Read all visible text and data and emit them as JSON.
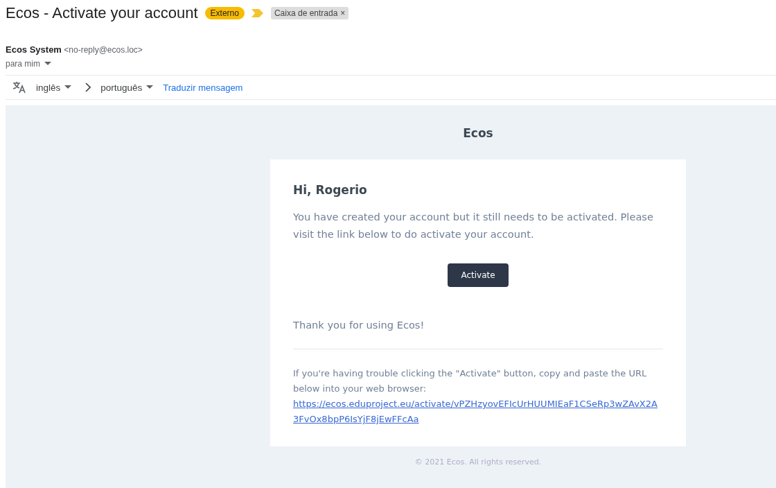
{
  "subject": "Ecos - Activate your account",
  "labels": [
    {
      "text": "Externo",
      "kind": "external"
    },
    {
      "text": "Caixa de entrada",
      "kind": "inbox",
      "close": "×"
    }
  ],
  "sender": {
    "name": "Ecos System",
    "address": "<no-reply@ecos.loc>",
    "recipient": "para mim"
  },
  "translate": {
    "from": "inglês",
    "to": "português",
    "action": "Traduzir mensagem"
  },
  "email": {
    "brand": "Ecos",
    "greeting": "Hi, Rogerio",
    "intro": "You have created your account but it still needs to be activated. Please visit the link below to do activate your account.",
    "button": "Activate",
    "thanks": "Thank you for using Ecos!",
    "trouble": "If you're having trouble clicking the \"Activate\" button, copy and paste the URL below into your web browser:",
    "url": "https://ecos.eduproject.eu/activate/vPZHzyovEFIcUrHUUMIEaF1CSeRp3wZAvX2A3FvOx8bpP6IsYjF8jEwFFcAa",
    "footer": "© 2021 Ecos. All rights reserved."
  }
}
